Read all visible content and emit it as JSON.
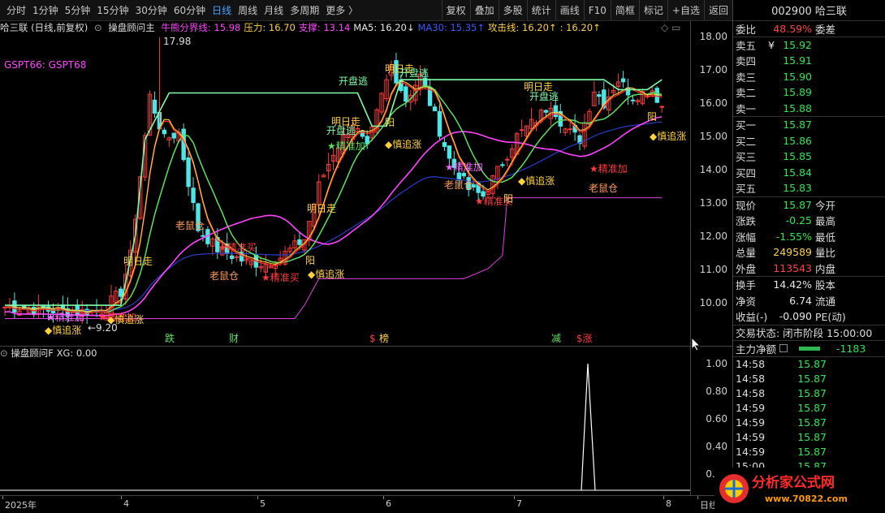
{
  "toolbar": {
    "periods": [
      "分时",
      "1分钟",
      "5分钟",
      "15分钟",
      "30分钟",
      "60分钟",
      "日线",
      "周线",
      "月线",
      "多周期",
      "更多 〉"
    ],
    "active_period": "日线",
    "actions": [
      "复权",
      "叠加",
      "多股",
      "统计",
      "画线",
      "F10",
      "简框",
      "标记",
      "+自选",
      "返回"
    ]
  },
  "legend": {
    "stock": "哈三联 (日线,前复权)",
    "collapse_icon": "circle-chevron-icon",
    "indicator": "操盘顾问主",
    "items": [
      {
        "text": "牛熊分界线: 15.98",
        "color": "#ff44ff"
      },
      {
        "text": "压力: 16.70",
        "color": "#ffd23a"
      },
      {
        "text": "支撑: 13.14",
        "color": "#ff44ff"
      },
      {
        "text": "MA5: 16.20↓",
        "color": "#e8e8e8"
      },
      {
        "text": "MA30: 15.35↑",
        "color": "#3a5cff"
      },
      {
        "text": "攻击线: 16.20↑",
        "color": "#ffd23a"
      },
      {
        "text": ": 16.20↑",
        "color": "#ffd23a"
      }
    ],
    "sub_label": "GSPT66: GSPT68",
    "corner_icons": "◇ ▭"
  },
  "price_axis": [
    "18.00",
    "17.00",
    "16.00",
    "15.00",
    "14.00",
    "13.00",
    "12.00",
    "11.00",
    "10.00"
  ],
  "lower": {
    "title": "操盘顾问F  XG: 0.00",
    "axis": [
      "1.00",
      "0.80",
      "0.60",
      "0.40",
      "0.20"
    ]
  },
  "chart_annotations": {
    "high": "17.98",
    "low": "←9.20",
    "buy_exact": "★精准加",
    "buy_exact2": "★精准买",
    "chase": "◆慎追涨",
    "leave": "明日走",
    "open_leave": "开盘逃",
    "old_rat": "老鼠仓",
    "yang": "阳",
    "events": [
      "跌",
      "财",
      "$",
      "榜",
      "减",
      "$涨"
    ]
  },
  "date_axis": [
    {
      "label": "2025年",
      "x": 6
    },
    {
      "label": "4",
      "x": 152
    },
    {
      "label": "5",
      "x": 320
    },
    {
      "label": "6",
      "x": 475
    },
    {
      "label": "7",
      "x": 636
    },
    {
      "label": "8",
      "x": 820
    },
    {
      "label": "日线",
      "x": 862
    }
  ],
  "chart_data": {
    "type": "candlestick",
    "series": [
      {
        "name": "MA5"
      },
      {
        "name": "MA30"
      }
    ],
    "ylim": [
      9.2,
      18.2
    ],
    "high_label": 17.98,
    "low_label": 9.2,
    "lower_ylim": [
      0,
      1.05
    ],
    "xg_values_note": "",
    "xg_spike": 1.0
  },
  "panel": {
    "code_name": "002900 哈三联",
    "ratio": {
      "label": "委比",
      "value": "48.59%",
      "label2": "委差"
    },
    "asks": [
      {
        "label": "卖五",
        "mark": "¥",
        "price": "15.92"
      },
      {
        "label": "卖四",
        "mark": "",
        "price": "15.91"
      },
      {
        "label": "卖三",
        "mark": "",
        "price": "15.90"
      },
      {
        "label": "卖二",
        "mark": "",
        "price": "15.89"
      },
      {
        "label": "卖一",
        "mark": "",
        "price": "15.88"
      }
    ],
    "bids": [
      {
        "label": "买一",
        "price": "15.87"
      },
      {
        "label": "买二",
        "price": "15.86"
      },
      {
        "label": "买三",
        "price": "15.85"
      },
      {
        "label": "买四",
        "price": "15.84"
      },
      {
        "label": "买五",
        "price": "15.83"
      }
    ],
    "stats": [
      {
        "l1": "现价",
        "v1": "15.87",
        "c1": "green",
        "l2": "今开"
      },
      {
        "l1": "涨跌",
        "v1": "-0.25",
        "c1": "green",
        "l2": "最高"
      },
      {
        "l1": "涨幅",
        "v1": "-1.55%",
        "c1": "green",
        "l2": "最低"
      },
      {
        "l1": "总量",
        "v1": "249589",
        "c1": "yellow",
        "l2": "量比"
      },
      {
        "l1": "外盘",
        "v1": "113543",
        "c1": "red",
        "l2": "内盘"
      }
    ],
    "stats2": [
      {
        "l1": "换手",
        "v1": "14.42%",
        "c1": "white",
        "l2": "股本"
      },
      {
        "l1": "净资",
        "v1": "6.74",
        "c1": "white",
        "l2": "流通"
      },
      {
        "l1": "收益(-)",
        "v1": "-0.090",
        "c1": "white",
        "l2": "PE(动)"
      }
    ],
    "trade_status": "交易状态: 闭市阶段 15:00:00",
    "main_flow": {
      "label": "主力净额",
      "value": "-1183"
    },
    "ticks": [
      {
        "t": "14:58",
        "p": "15.87"
      },
      {
        "t": "14:58",
        "p": "15.87"
      },
      {
        "t": "14:58",
        "p": "15.87"
      },
      {
        "t": "14:59",
        "p": "15.87"
      },
      {
        "t": "14:59",
        "p": "15.87"
      },
      {
        "t": "14:59",
        "p": "15.87"
      },
      {
        "t": "14:59",
        "p": "15.87"
      },
      {
        "t": "15:00",
        "p": "15.87"
      }
    ]
  },
  "logo": {
    "text": "分析家公式网",
    "url_text": "www.70822.com"
  }
}
